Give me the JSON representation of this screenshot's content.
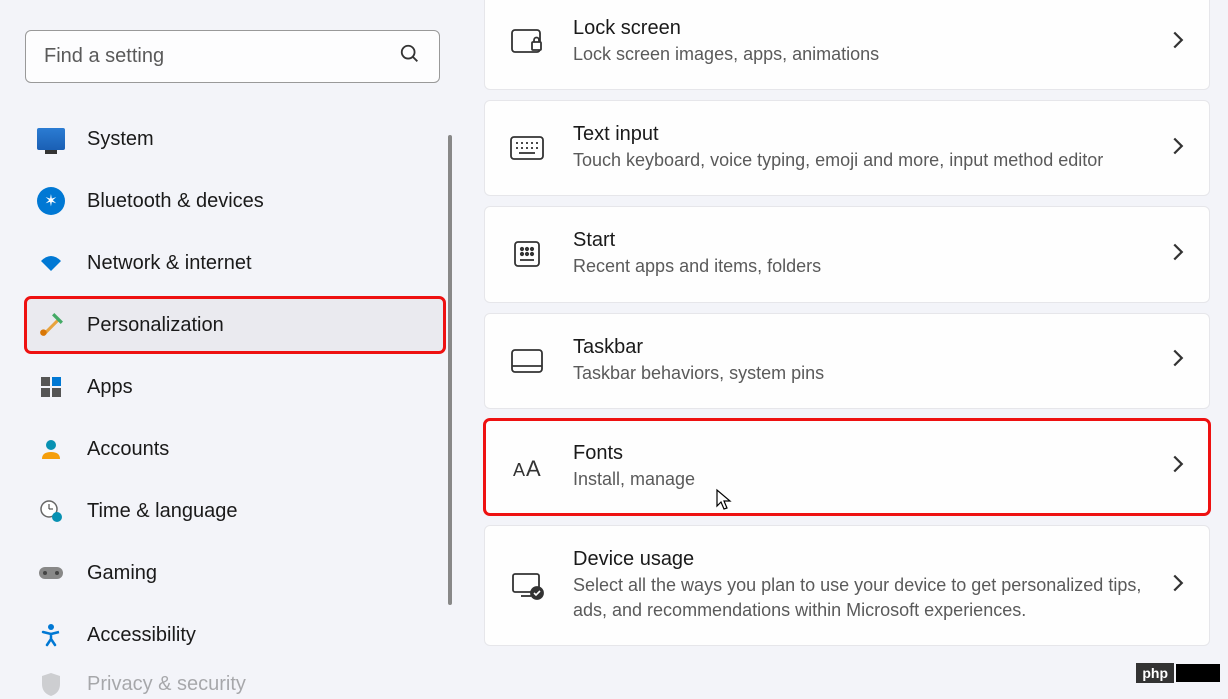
{
  "search": {
    "placeholder": "Find a setting"
  },
  "sidebar": {
    "items": [
      {
        "label": "System"
      },
      {
        "label": "Bluetooth & devices"
      },
      {
        "label": "Network & internet"
      },
      {
        "label": "Personalization"
      },
      {
        "label": "Apps"
      },
      {
        "label": "Accounts"
      },
      {
        "label": "Time & language"
      },
      {
        "label": "Gaming"
      },
      {
        "label": "Accessibility"
      },
      {
        "label": "Privacy & security"
      }
    ]
  },
  "main": {
    "cards": [
      {
        "title": "Lock screen",
        "desc": "Lock screen images, apps, animations"
      },
      {
        "title": "Text input",
        "desc": "Touch keyboard, voice typing, emoji and more, input method editor"
      },
      {
        "title": "Start",
        "desc": "Recent apps and items, folders"
      },
      {
        "title": "Taskbar",
        "desc": "Taskbar behaviors, system pins"
      },
      {
        "title": "Fonts",
        "desc": "Install, manage"
      },
      {
        "title": "Device usage",
        "desc": "Select all the ways you plan to use your device to get personalized tips, ads, and recommendations within Microsoft experiences."
      }
    ]
  },
  "watermark": {
    "text": "php"
  }
}
